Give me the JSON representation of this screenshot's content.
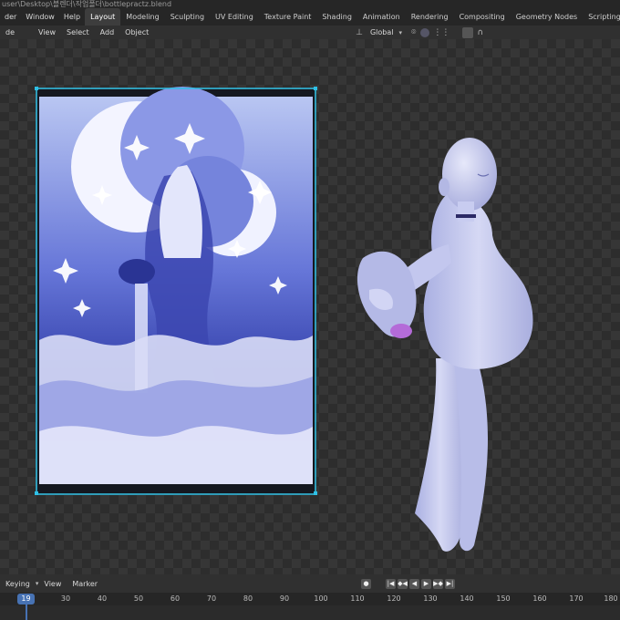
{
  "window": {
    "path": "user\\Desktop\\블렌더\\작업폴더\\bottlepractz.blend"
  },
  "menu": [
    "der",
    "Window",
    "Help"
  ],
  "workspaces": [
    "Layout",
    "Modeling",
    "Sculpting",
    "UV Editing",
    "Texture Paint",
    "Shading",
    "Animation",
    "Rendering",
    "Compositing",
    "Geometry Nodes",
    "Scripting"
  ],
  "active_workspace": "Layout",
  "viewport_header": {
    "mode": "de",
    "items": [
      "View",
      "Select",
      "Add",
      "Object"
    ],
    "transform_orientation": "Global"
  },
  "timeline": {
    "keying": "Keying",
    "items": [
      "View",
      "Marker"
    ],
    "current_frame": "19",
    "ticks": [
      "30",
      "40",
      "50",
      "60",
      "70",
      "80",
      "90",
      "100",
      "110",
      "120",
      "130",
      "140",
      "150",
      "160",
      "170",
      "180"
    ]
  },
  "colors": {
    "accent": "#4772b3",
    "selection": "#2ec0e6",
    "figure": "#c4c8ef"
  },
  "icons": {
    "plus": "+",
    "play": "▶"
  }
}
